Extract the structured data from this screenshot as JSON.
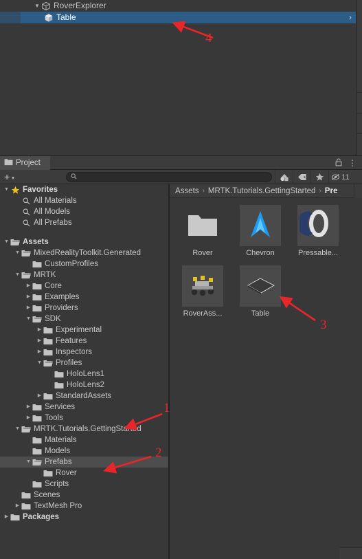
{
  "hierarchy": {
    "rows": [
      {
        "label": "RoverExplorer",
        "icon": "prefab-cube-outline-icon",
        "indent": 1,
        "expander": "open",
        "selected": false
      },
      {
        "label": "Table",
        "icon": "gameobject-cube-icon",
        "indent": 2,
        "expander": "none",
        "selected": true,
        "chevron": "›"
      }
    ]
  },
  "project": {
    "tab": {
      "label": "Project",
      "icon": "folder-icon"
    },
    "tab_icons": {
      "lock": "🔓",
      "menu": "⋮"
    },
    "toolbar": {
      "add_label": "+",
      "add_caret": "▾",
      "search_value": "",
      "search_placeholder": "",
      "search_icon": "search-icon",
      "filter_type_icon": "filter-by-type-icon",
      "filter_label_icon": "filter-by-label-icon",
      "favorite_icon": "star-icon",
      "hidden_icon": "hidden-eye-icon",
      "hidden_count": "11"
    },
    "tree": [
      {
        "label": "Favorites",
        "icon": "star-icon",
        "indent": 0,
        "expander": "open",
        "bold": true,
        "selected": false
      },
      {
        "label": "All Materials",
        "icon": "search-icon",
        "indent": 1,
        "expander": "none",
        "bold": false,
        "selected": false
      },
      {
        "label": "All Models",
        "icon": "search-icon",
        "indent": 1,
        "expander": "none",
        "bold": false,
        "selected": false
      },
      {
        "label": "All Prefabs",
        "icon": "search-icon",
        "indent": 1,
        "expander": "none",
        "bold": false,
        "selected": false
      },
      {
        "label": "",
        "icon": "spacer",
        "indent": 0,
        "expander": "none",
        "bold": false,
        "selected": false
      },
      {
        "label": "Assets",
        "icon": "folder-open-icon",
        "indent": 0,
        "expander": "open",
        "bold": true,
        "selected": false
      },
      {
        "label": "MixedRealityToolkit.Generated",
        "icon": "folder-open-icon",
        "indent": 1,
        "expander": "open",
        "bold": false,
        "selected": false
      },
      {
        "label": "CustomProfiles",
        "icon": "folder-icon",
        "indent": 2,
        "expander": "none",
        "bold": false,
        "selected": false
      },
      {
        "label": "MRTK",
        "icon": "folder-open-icon",
        "indent": 1,
        "expander": "open",
        "bold": false,
        "selected": false
      },
      {
        "label": "Core",
        "icon": "folder-icon",
        "indent": 2,
        "expander": "closed",
        "bold": false,
        "selected": false
      },
      {
        "label": "Examples",
        "icon": "folder-icon",
        "indent": 2,
        "expander": "closed",
        "bold": false,
        "selected": false
      },
      {
        "label": "Providers",
        "icon": "folder-icon",
        "indent": 2,
        "expander": "closed",
        "bold": false,
        "selected": false
      },
      {
        "label": "SDK",
        "icon": "folder-open-icon",
        "indent": 2,
        "expander": "open",
        "bold": false,
        "selected": false
      },
      {
        "label": "Experimental",
        "icon": "folder-icon",
        "indent": 3,
        "expander": "closed",
        "bold": false,
        "selected": false
      },
      {
        "label": "Features",
        "icon": "folder-icon",
        "indent": 3,
        "expander": "closed",
        "bold": false,
        "selected": false
      },
      {
        "label": "Inspectors",
        "icon": "folder-icon",
        "indent": 3,
        "expander": "closed",
        "bold": false,
        "selected": false
      },
      {
        "label": "Profiles",
        "icon": "folder-open-icon",
        "indent": 3,
        "expander": "open",
        "bold": false,
        "selected": false
      },
      {
        "label": "HoloLens1",
        "icon": "folder-icon",
        "indent": 4,
        "expander": "none",
        "bold": false,
        "selected": false
      },
      {
        "label": "HoloLens2",
        "icon": "folder-icon",
        "indent": 4,
        "expander": "none",
        "bold": false,
        "selected": false
      },
      {
        "label": "StandardAssets",
        "icon": "folder-icon",
        "indent": 3,
        "expander": "closed",
        "bold": false,
        "selected": false
      },
      {
        "label": "Services",
        "icon": "folder-icon",
        "indent": 2,
        "expander": "closed",
        "bold": false,
        "selected": false
      },
      {
        "label": "Tools",
        "icon": "folder-icon",
        "indent": 2,
        "expander": "closed",
        "bold": false,
        "selected": false
      },
      {
        "label": "MRTK.Tutorials.GettingStarted",
        "icon": "folder-open-icon",
        "indent": 1,
        "expander": "open",
        "bold": false,
        "selected": false
      },
      {
        "label": "Materials",
        "icon": "folder-icon",
        "indent": 2,
        "expander": "none",
        "bold": false,
        "selected": false
      },
      {
        "label": "Models",
        "icon": "folder-icon",
        "indent": 2,
        "expander": "none",
        "bold": false,
        "selected": false
      },
      {
        "label": "Prefabs",
        "icon": "folder-open-icon",
        "indent": 2,
        "expander": "open",
        "bold": false,
        "selected": true
      },
      {
        "label": "Rover",
        "icon": "folder-icon",
        "indent": 3,
        "expander": "none",
        "bold": false,
        "selected": false
      },
      {
        "label": "Scripts",
        "icon": "folder-icon",
        "indent": 2,
        "expander": "none",
        "bold": false,
        "selected": false
      },
      {
        "label": "Scenes",
        "icon": "folder-icon",
        "indent": 1,
        "expander": "none",
        "bold": false,
        "selected": false
      },
      {
        "label": "TextMesh Pro",
        "icon": "folder-icon",
        "indent": 1,
        "expander": "closed",
        "bold": false,
        "selected": false
      },
      {
        "label": "Packages",
        "icon": "folder-icon",
        "indent": 0,
        "expander": "closed",
        "bold": true,
        "selected": false
      }
    ],
    "breadcrumb": {
      "separator": "›",
      "items": [
        {
          "label": "Assets",
          "current": false
        },
        {
          "label": "MRTK.Tutorials.GettingStarted",
          "current": false
        },
        {
          "label": "Pre",
          "current": true
        }
      ]
    },
    "assets": [
      {
        "name": "Rover",
        "thumb": "folder-thumb",
        "selected": false
      },
      {
        "name": "Chevron",
        "thumb": "chevron-prefab-thumb",
        "selected": false
      },
      {
        "name": "Pressable...",
        "thumb": "pressable-button-thumb",
        "selected": false
      },
      {
        "name": "RoverAss...",
        "thumb": "rover-assembly-thumb",
        "selected": false
      },
      {
        "name": "Table",
        "thumb": "table-thumb",
        "selected": false
      }
    ],
    "statusbar": {
      "zoom_handle": true
    }
  },
  "annotations": [
    {
      "number": "4",
      "color": "#e8262a"
    },
    {
      "number": "3",
      "color": "#e8262a"
    },
    {
      "number": "1",
      "color": "#e8262a"
    },
    {
      "number": "2",
      "color": "#e8262a"
    }
  ],
  "colors": {
    "background": "#383838",
    "panel": "#3c3c3c",
    "selection_blue": "#2c5d87",
    "selection_gray": "#4d4d4d",
    "annotation_red": "#e8262a",
    "folder": "#c4c4c4",
    "favorite_star": "#e8c020"
  }
}
